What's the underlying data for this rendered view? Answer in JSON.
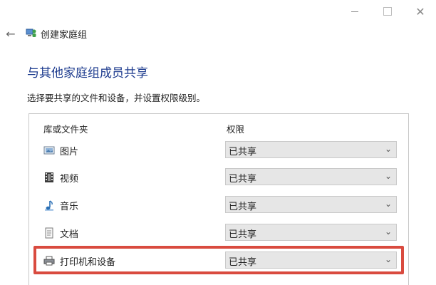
{
  "window": {
    "minimize_glyph": "",
    "maximize_glyph": "",
    "close_glyph": "✕"
  },
  "nav": {
    "back_glyph": "←",
    "title": "创建家庭组"
  },
  "heading": "与其他家庭组成员共享",
  "description": "选择要共享的文件和设备，并设置权限级别。",
  "table": {
    "col_folder": "库或文件夹",
    "col_permission": "权限",
    "rows": [
      {
        "label": "图片",
        "icon": "pictures-icon",
        "permission": "已共享"
      },
      {
        "label": "视频",
        "icon": "videos-icon",
        "permission": "已共享"
      },
      {
        "label": "音乐",
        "icon": "music-icon",
        "permission": "已共享"
      },
      {
        "label": "文档",
        "icon": "documents-icon",
        "permission": "已共享"
      },
      {
        "label": "打印机和设备",
        "icon": "printer-icon",
        "permission": "已共享",
        "highlighted": true
      }
    ]
  },
  "colors": {
    "heading": "#1e3c8f",
    "highlight": "#d94b3f",
    "dropdown_bg": "#e6e6e6"
  }
}
